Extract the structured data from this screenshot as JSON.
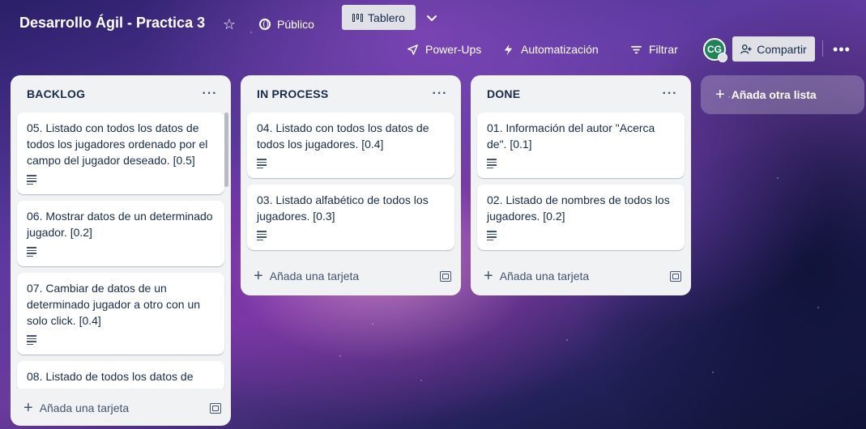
{
  "header": {
    "board_title": "Desarrollo Ágil - Practica 3",
    "visibility": "Público",
    "view_tab": "Tablero",
    "powerups": "Power-Ups",
    "automation": "Automatización",
    "filter": "Filtrar",
    "avatar_initials": "CG",
    "share": "Compartir"
  },
  "lists": [
    {
      "title": "BACKLOG",
      "cards": [
        "05. Listado con todos los datos de todos los jugadores ordenado por el campo del jugador deseado. [0.5]",
        "06. Mostrar datos de un determinado jugador. [0.2]",
        "07. Cambiar de datos de un determinado jugador a otro con un solo click. [0.4]",
        "08. Listado de todos los datos de"
      ],
      "add_card": "Añada una tarjeta"
    },
    {
      "title": "IN PROCESS",
      "cards": [
        "04. Listado con todos los datos de todos los jugadores. [0.4]",
        "03. Listado alfabético de todos los jugadores. [0.3]"
      ],
      "add_card": "Añada una tarjeta"
    },
    {
      "title": "DONE",
      "cards": [
        "01. Información del autor \"Acerca de\". [0.1]",
        "02. Listado de nombres de todos los jugadores. [0.2]"
      ],
      "add_card": "Añada una tarjeta"
    }
  ],
  "add_list": "Añada otra lista",
  "colors": {
    "list_bg": "#f1f2f4",
    "text": "#172b4d",
    "avatar": "#1f845a",
    "button_bg": "#dfe1e6"
  }
}
